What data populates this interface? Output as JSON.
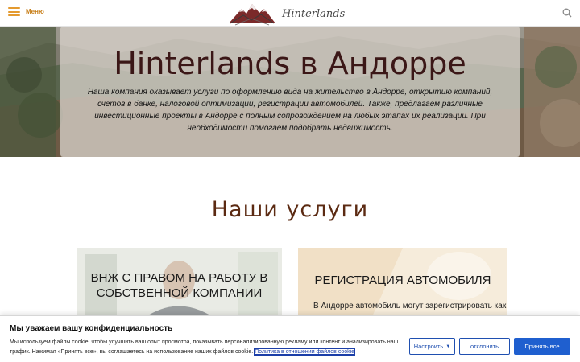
{
  "header": {
    "menu_label": "Меню",
    "logo_text": "Hinterlands",
    "search_icon": "search-icon",
    "accent_color": "#e49a2f"
  },
  "hero": {
    "title": "Hinterlands в Андорре",
    "description": "Наша компания оказывает услуги по оформлению вида на жительство в Андорре, открытию компаний, счетов в банке, налоговой оптимизации, регистрации автомобилей. Также, предлагаем различные инвестиционные проекты в Андорре с полным сопровождением на любых этапах их реализации. При необходимости помогаем подобрать недвижимость."
  },
  "services": {
    "title": "Наши услуги",
    "cards": [
      {
        "title_line1": "ВНЖ С ПРАВОМ НА РАБОТУ В",
        "title_line2": "СОБСТВЕННОЙ КОМПАНИИ",
        "text": ""
      },
      {
        "title_line1": "РЕГИСТРАЦИЯ АВТОМОБИЛЯ",
        "title_line2": "",
        "text": "В Андорре автомобиль могут зарегистрировать как"
      }
    ]
  },
  "cookie": {
    "title": "Мы уважаем вашу конфиденциальность",
    "text": "Мы используем файлы cookie, чтобы улучшить ваш опыт просмотра, показывать персонализированную рекламу или контент и анализировать наш трафик. Нажимая «Принять все», вы соглашаетесь на использование наших файлов cookie.",
    "policy_link": "Политика в отношении файлов cookie",
    "settings_label": "Настроить",
    "reject_label": "отклонить",
    "accept_label": "Принять все",
    "button_color": "#1f5fcf"
  }
}
